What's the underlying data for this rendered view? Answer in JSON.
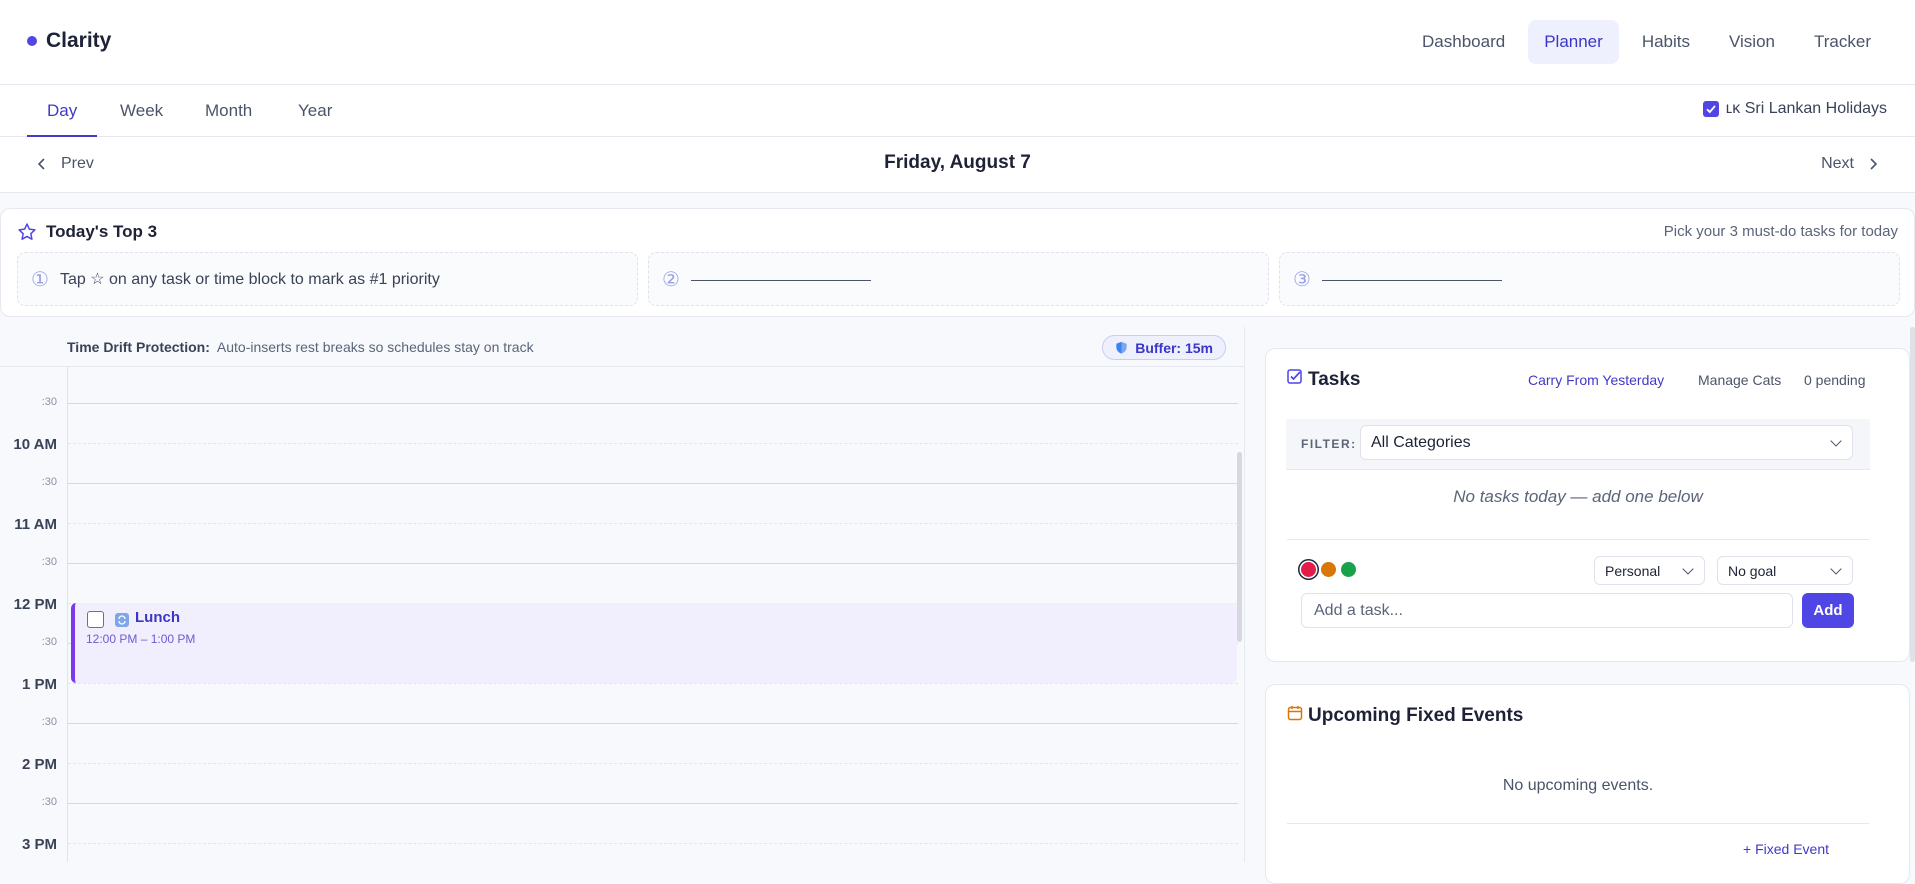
{
  "app": {
    "name": "Clarity",
    "accent": "#4f46e5"
  },
  "nav": {
    "items": [
      {
        "label": "Dashboard",
        "active": false
      },
      {
        "label": "Planner",
        "active": true
      },
      {
        "label": "Habits",
        "active": false
      },
      {
        "label": "Vision",
        "active": false
      },
      {
        "label": "Tracker",
        "active": false
      }
    ]
  },
  "view_tabs": {
    "items": [
      {
        "label": "Day",
        "active": true
      },
      {
        "label": "Week",
        "active": false
      },
      {
        "label": "Month",
        "active": false
      },
      {
        "label": "Year",
        "active": false
      }
    ]
  },
  "holidays": {
    "label": "ʟᴋ Sri Lankan Holidays",
    "checked": true
  },
  "date_nav": {
    "prev": "Prev",
    "next": "Next",
    "title": "Friday, August 7"
  },
  "top3": {
    "title": "Today's Top 3",
    "hint": "Pick your 3 must-do tasks for today",
    "slots": [
      {
        "number": "①",
        "text": "Tap ☆ on any task or time block to mark as #1 priority"
      },
      {
        "number": "②",
        "text": ""
      },
      {
        "number": "③",
        "text": ""
      }
    ]
  },
  "drift": {
    "label": "Time Drift Protection:",
    "description": "Auto-inserts rest breaks so schedules stay on track",
    "buffer": "Buffer: 15m"
  },
  "calendar": {
    "labels": [
      ":30",
      "10 AM",
      ":30",
      "11 AM",
      ":30",
      "12 PM",
      ":30",
      "1 PM",
      ":30",
      "2 PM",
      ":30",
      "3 PM"
    ],
    "event": {
      "name": "Lunch",
      "time": "12:00 PM – 1:00 PM",
      "color": "#7c3aed"
    }
  },
  "tasks": {
    "title": "Tasks",
    "carry": "Carry From Yesterday",
    "manage": "Manage Cats",
    "pending": "0 pending",
    "filter_label": "FILTER:",
    "filter_value": "All Categories",
    "empty": "No tasks today — add one below",
    "priority_colors": [
      "#e11d48",
      "#d97706",
      "#16a34a"
    ],
    "category": "Personal",
    "goal": "No goal",
    "placeholder": "Add a task...",
    "add": "Add"
  },
  "events": {
    "title": "Upcoming Fixed Events",
    "empty": "No upcoming events.",
    "add": "+ Fixed Event"
  }
}
